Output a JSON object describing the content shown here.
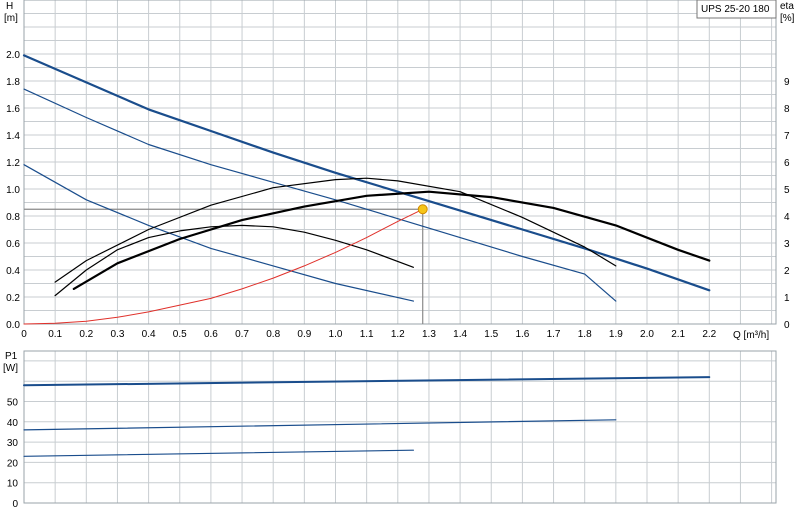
{
  "chart_data": [
    {
      "type": "line",
      "model_label": "UPS 25-20 180",
      "y_label_left": "H",
      "y_unit_left": "[m]",
      "y_label_right": "eta",
      "y_unit_right": "[%]",
      "x_label": "Q [m³/h]",
      "xlim": [
        0,
        2.25
      ],
      "ylim": [
        0,
        2.2
      ],
      "ylim_right": [
        0,
        11
      ],
      "grid": true,
      "x_ticks": [
        "0",
        "0.1",
        "0.2",
        "0.3",
        "0.4",
        "0.5",
        "0.6",
        "0.7",
        "0.8",
        "0.9",
        "1.0",
        "1.1",
        "1.2",
        "1.3",
        "1.4",
        "1.5",
        "1.6",
        "1.7",
        "1.8",
        "1.9",
        "2.0",
        "2.1",
        "2.2"
      ],
      "y_ticks": [
        "0.0",
        "0.2",
        "0.4",
        "0.6",
        "0.8",
        "1.0",
        "1.2",
        "1.4",
        "1.6",
        "1.8",
        "2.0"
      ],
      "y_ticks_right": [
        "0",
        "1",
        "2",
        "3",
        "4",
        "5",
        "6",
        "7",
        "8",
        "9"
      ],
      "series": [
        {
          "role": "head",
          "speed": 3,
          "color": "#1a4d8c",
          "width": 2.2,
          "x": [
            0,
            0.2,
            0.4,
            0.6,
            0.8,
            1.0,
            1.2,
            1.4,
            1.6,
            1.8,
            2.0,
            2.2
          ],
          "y": [
            1.99,
            1.79,
            1.59,
            1.43,
            1.27,
            1.12,
            0.98,
            0.84,
            0.7,
            0.56,
            0.41,
            0.25
          ]
        },
        {
          "role": "head",
          "speed": 2,
          "color": "#1a4d8c",
          "width": 1.2,
          "x": [
            0,
            0.2,
            0.4,
            0.6,
            0.8,
            1.0,
            1.2,
            1.4,
            1.6,
            1.8,
            1.9
          ],
          "y": [
            1.74,
            1.53,
            1.33,
            1.18,
            1.05,
            0.92,
            0.78,
            0.64,
            0.5,
            0.37,
            0.17
          ]
        },
        {
          "role": "head",
          "speed": 1,
          "color": "#1a4d8c",
          "width": 1.2,
          "x": [
            0,
            0.2,
            0.4,
            0.6,
            0.8,
            1.0,
            1.25
          ],
          "y": [
            1.18,
            0.92,
            0.73,
            0.56,
            0.43,
            0.3,
            0.17
          ]
        },
        {
          "role": "efficiency",
          "speed": 3,
          "color": "#000000",
          "width": 2.2,
          "x": [
            0.16,
            0.3,
            0.5,
            0.7,
            0.9,
            1.1,
            1.3,
            1.5,
            1.7,
            1.9,
            2.1,
            2.2
          ],
          "y": [
            0.26,
            0.45,
            0.63,
            0.77,
            0.87,
            0.95,
            0.98,
            0.94,
            0.86,
            0.73,
            0.55,
            0.47
          ]
        },
        {
          "role": "efficiency",
          "speed": 2,
          "color": "#000000",
          "width": 1.2,
          "x": [
            0.1,
            0.2,
            0.4,
            0.6,
            0.8,
            1.0,
            1.1,
            1.2,
            1.4,
            1.6,
            1.8,
            1.9
          ],
          "y": [
            0.31,
            0.47,
            0.7,
            0.88,
            1.01,
            1.07,
            1.08,
            1.06,
            0.98,
            0.79,
            0.57,
            0.43
          ]
        },
        {
          "role": "efficiency",
          "speed": 1,
          "color": "#000000",
          "width": 1.2,
          "x": [
            0.1,
            0.2,
            0.3,
            0.4,
            0.5,
            0.6,
            0.7,
            0.8,
            0.9,
            1.0,
            1.1,
            1.25
          ],
          "y": [
            0.21,
            0.4,
            0.55,
            0.64,
            0.69,
            0.72,
            0.73,
            0.72,
            0.68,
            0.62,
            0.55,
            0.42
          ]
        },
        {
          "role": "system-curve",
          "color": "#e0302a",
          "width": 1.0,
          "x": [
            0,
            0.1,
            0.2,
            0.3,
            0.4,
            0.5,
            0.6,
            0.7,
            0.8,
            0.9,
            1.0,
            1.1,
            1.2,
            1.28
          ],
          "y": [
            0,
            0.005,
            0.02,
            0.05,
            0.09,
            0.14,
            0.19,
            0.26,
            0.34,
            0.43,
            0.53,
            0.64,
            0.76,
            0.85
          ]
        }
      ],
      "operating_point": {
        "x": 1.28,
        "y": 0.85,
        "color": "#f5c518"
      }
    },
    {
      "type": "line",
      "y_label": "P1",
      "y_unit": "[W]",
      "xlim": [
        0,
        2.25
      ],
      "ylim": [
        0,
        70
      ],
      "grid": true,
      "y_ticks": [
        "0",
        "10",
        "20",
        "30",
        "40",
        "50"
      ],
      "series": [
        {
          "speed": 3,
          "color": "#1a4d8c",
          "width": 2.0,
          "x": [
            0,
            2.2
          ],
          "y": [
            58,
            62
          ]
        },
        {
          "speed": 2,
          "color": "#1a4d8c",
          "width": 1.2,
          "x": [
            0,
            1.9
          ],
          "y": [
            36,
            41
          ]
        },
        {
          "speed": 1,
          "color": "#1a4d8c",
          "width": 1.2,
          "x": [
            0,
            1.25
          ],
          "y": [
            23,
            26
          ]
        }
      ]
    }
  ]
}
